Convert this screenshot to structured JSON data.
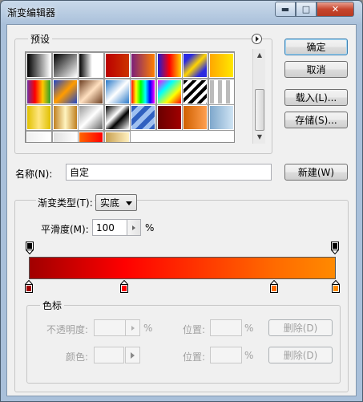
{
  "window": {
    "title": "渐变编辑器",
    "controls": {
      "minimize": "▬",
      "maximize": "□",
      "close": "✕"
    }
  },
  "presets": {
    "legend": "预设",
    "menu_icon": "circle-arrow-icon",
    "swatches": [
      "linear-gradient(90deg,#000,#fff)",
      "linear-gradient(135deg,#000 0%,rgba(0,0,0,0) 100%)",
      "linear-gradient(90deg,#000,#fff 55%,#fff)",
      "linear-gradient(90deg,#b00,#c30)",
      "linear-gradient(90deg,#7a1f7a,#ff7f00)",
      "linear-gradient(90deg,#1c1cd6,#ff0000,#ffd400)",
      "linear-gradient(135deg,#2b2be0 20%,#ffd400 50%,#2b2be0 80%)",
      "linear-gradient(90deg,#ffa800,#ffe800)",
      "linear-gradient(90deg,#6e2fa0,#ff0000,#ffc800,#2ca02c)",
      "linear-gradient(135deg,#1d45c8,#ff9c00 50%,#1d45c8)",
      "linear-gradient(135deg,#6b3d20,#ffe0c0 50%,#6b3d20)",
      "linear-gradient(135deg,#2878c8,#fff 50%,#2878c8)",
      "linear-gradient(90deg,#ff0000,#ffff00,#00ff00,#00ffff,#0000ff,#ff00ff)",
      "linear-gradient(135deg,#ff00ff,#00ffff,#ffff00,#ff0000)",
      "repeating-linear-gradient(135deg,#000 0 4px,#fff 4px 8px)",
      "repeating-linear-gradient(90deg,#bbb 0 5px,#fff 5px 10px)",
      "linear-gradient(90deg,#e0c000,#ffe680,#e0c000)",
      "linear-gradient(90deg,#c08020,#fff4c0,#c08020)",
      "linear-gradient(135deg,#999,#fff 50%,#666)",
      "linear-gradient(135deg,#000,#fff 40%,#000 60%,#fff)",
      "repeating-linear-gradient(135deg,#3060c0 0 6px,#9fc0f0 6px 12px)",
      "linear-gradient(90deg,#6a0000,#a00000)",
      "linear-gradient(90deg,#d06000,#ffa050)",
      "linear-gradient(90deg,#7fa8cc,#cfe4f4)",
      "linear-gradient(90deg,#f0f0f0,#fff)",
      "linear-gradient(90deg,#e0e0e0,#fff)",
      "linear-gradient(90deg,#ff6600,#ff0000)",
      "linear-gradient(90deg,#c8a050,#fff0c0)"
    ]
  },
  "buttons": {
    "ok": "确定",
    "cancel": "取消",
    "load": "载入(L)...",
    "save": "存储(S)...",
    "new": "新建(W)"
  },
  "name": {
    "label": "名称(N):",
    "value": "自定"
  },
  "gradient_type": {
    "label": "渐变类型(T):",
    "value": "实底"
  },
  "smoothness": {
    "label": "平滑度(M):",
    "value": "100",
    "unit": "%"
  },
  "gradient": {
    "colors": [
      "#a00000",
      "#ff0000",
      "#ff6a00",
      "#ff8a00"
    ],
    "opacity_stop_color": "#000000",
    "color_stops": [
      {
        "color": "#a00000",
        "location": 0
      },
      {
        "color": "#ff0000",
        "location": 31
      },
      {
        "color": "#ff6a00",
        "location": 80
      },
      {
        "color": "#ff8a00",
        "location": 100
      }
    ]
  },
  "stops": {
    "legend": "色标",
    "opacity_label": "不透明度:",
    "opacity_unit": "%",
    "position_label": "位置:",
    "position_unit": "%",
    "delete_label": "删除(D)",
    "color_label": "颜色:"
  }
}
